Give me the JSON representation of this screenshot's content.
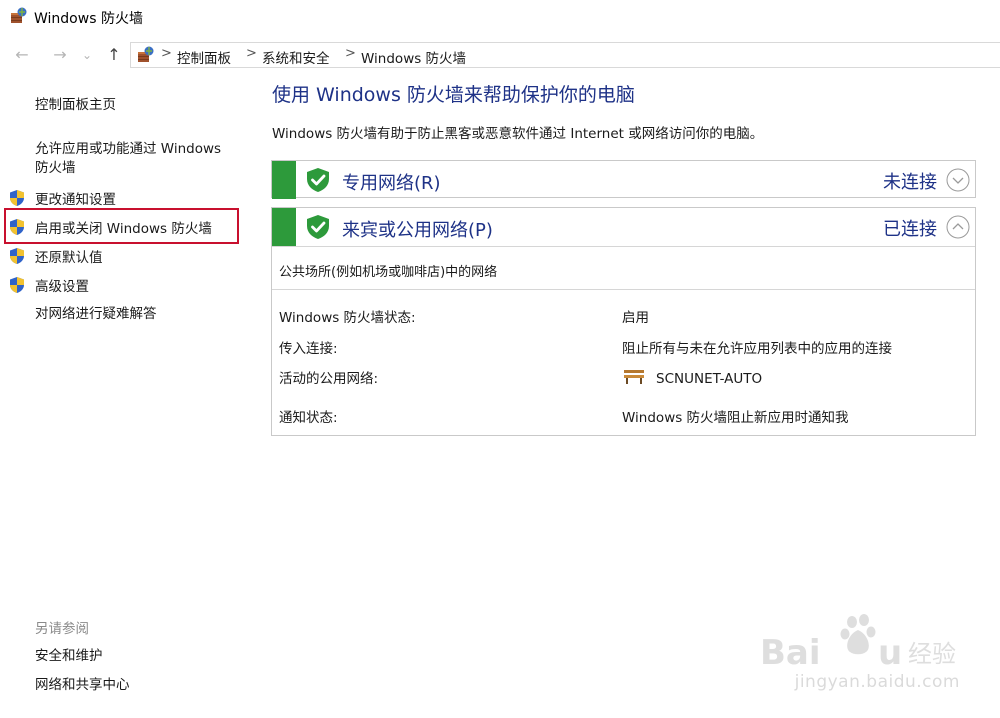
{
  "window": {
    "title": "Windows 防火墙"
  },
  "address": {
    "crumbs": [
      "控制面板",
      "系统和安全",
      "Windows 防火墙"
    ],
    "separator": ">"
  },
  "nav": {
    "back_icon": "←",
    "forward_icon": "→",
    "dropdown_icon": "⌄",
    "up_icon": "↑"
  },
  "sidebar": {
    "home": "控制面板主页",
    "allow_app": "允许应用或功能通过 Windows 防火墙",
    "allow_app_line1": "允许应用或功能通过 Windows",
    "allow_app_line2": "防火墙",
    "items": [
      {
        "label": "更改通知设置",
        "shield": true
      },
      {
        "label": "启用或关闭 Windows 防火墙",
        "shield": true
      },
      {
        "label": "还原默认值",
        "shield": true
      },
      {
        "label": "高级设置",
        "shield": true
      }
    ],
    "troubleshoot": "对网络进行疑难解答",
    "see_also": {
      "title": "另请参阅",
      "links": [
        "安全和维护",
        "网络和共享中心"
      ]
    }
  },
  "main": {
    "title": "使用 Windows 防火墙来帮助保护你的电脑",
    "description": "Windows 防火墙有助于防止黑客或恶意软件通过 Internet 或网络访问你的电脑。",
    "private": {
      "name": "专用网络(R)",
      "status": "未连接",
      "expanded": false
    },
    "public": {
      "name": "来宾或公用网络(P)",
      "status": "已连接",
      "expanded": true,
      "subtitle": "公共场所(例如机场或咖啡店)中的网络",
      "rows": [
        {
          "label": "Windows 防火墙状态:",
          "value": "启用"
        },
        {
          "label": "传入连接:",
          "value": "阻止所有与未在允许应用列表中的应用的连接"
        },
        {
          "label": "活动的公用网络:",
          "value": "SCNUNET-AUTO"
        },
        {
          "label": "通知状态:",
          "value": "Windows 防火墙阻止新应用时通知我"
        }
      ]
    }
  },
  "watermark": {
    "brand": "Baidu经验",
    "url": "jingyan.baidu.com"
  },
  "colors": {
    "accent_blue": "#1e3287",
    "status_green": "#2d9a3b",
    "highlight_red": "#c8102e"
  }
}
